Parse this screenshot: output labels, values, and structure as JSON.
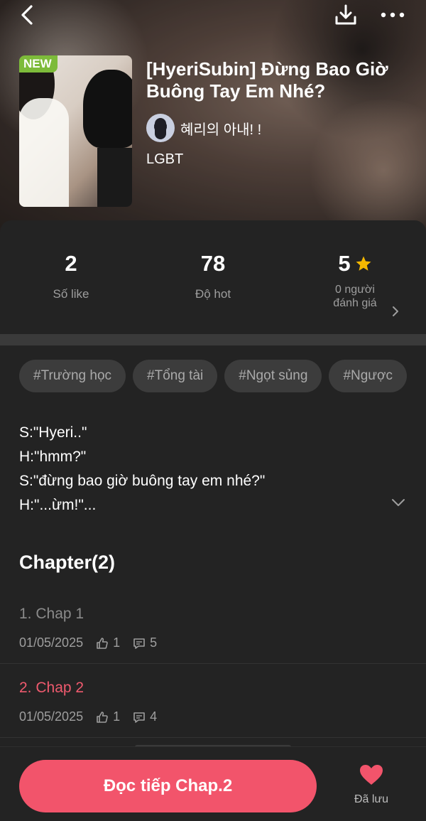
{
  "header": {
    "new_badge": "NEW",
    "title": "[HyeriSubin] Đừng Bao Giờ Buông Tay Em Nhé?",
    "author": "혜리의 아내! !",
    "genre": "LGBT"
  },
  "stats": {
    "likes": {
      "value": "2",
      "label": "Số like"
    },
    "hot": {
      "value": "78",
      "label": "Độ hot"
    },
    "rating": {
      "value": "5",
      "label_line1": "0 người",
      "label_line2": "đánh giá"
    }
  },
  "tags": [
    "#Trường học",
    "#Tổng tài",
    "#Ngọt sủng",
    "#Ngược"
  ],
  "description": {
    "lines": [
      "S:\"Hyeri..\"",
      "H:\"hmm?\"",
      "S:\"đừng bao giờ buông tay em nhé?\"",
      "H:\"...ừm!\"..."
    ]
  },
  "chapters": {
    "heading": "Chapter(2)",
    "items": [
      {
        "title": "1. Chap 1",
        "date": "01/05/2025",
        "likes": "1",
        "comments": "5"
      },
      {
        "title": "2. Chap 2",
        "date": "01/05/2025",
        "likes": "1",
        "comments": "4"
      }
    ]
  },
  "bottom": {
    "read_label": "Đọc tiếp Chap.2",
    "save_label": "Đã lưu"
  },
  "colors": {
    "accent": "#f2546b",
    "active_chapter": "#ef5a6e",
    "star": "#f5b800",
    "new_badge": "#7dbb3a"
  },
  "icons": [
    "back-icon",
    "download-icon",
    "more-icon",
    "star-icon",
    "chevron-right-icon",
    "chevron-down-icon",
    "thumbs-up-icon",
    "comment-icon",
    "heart-icon"
  ]
}
